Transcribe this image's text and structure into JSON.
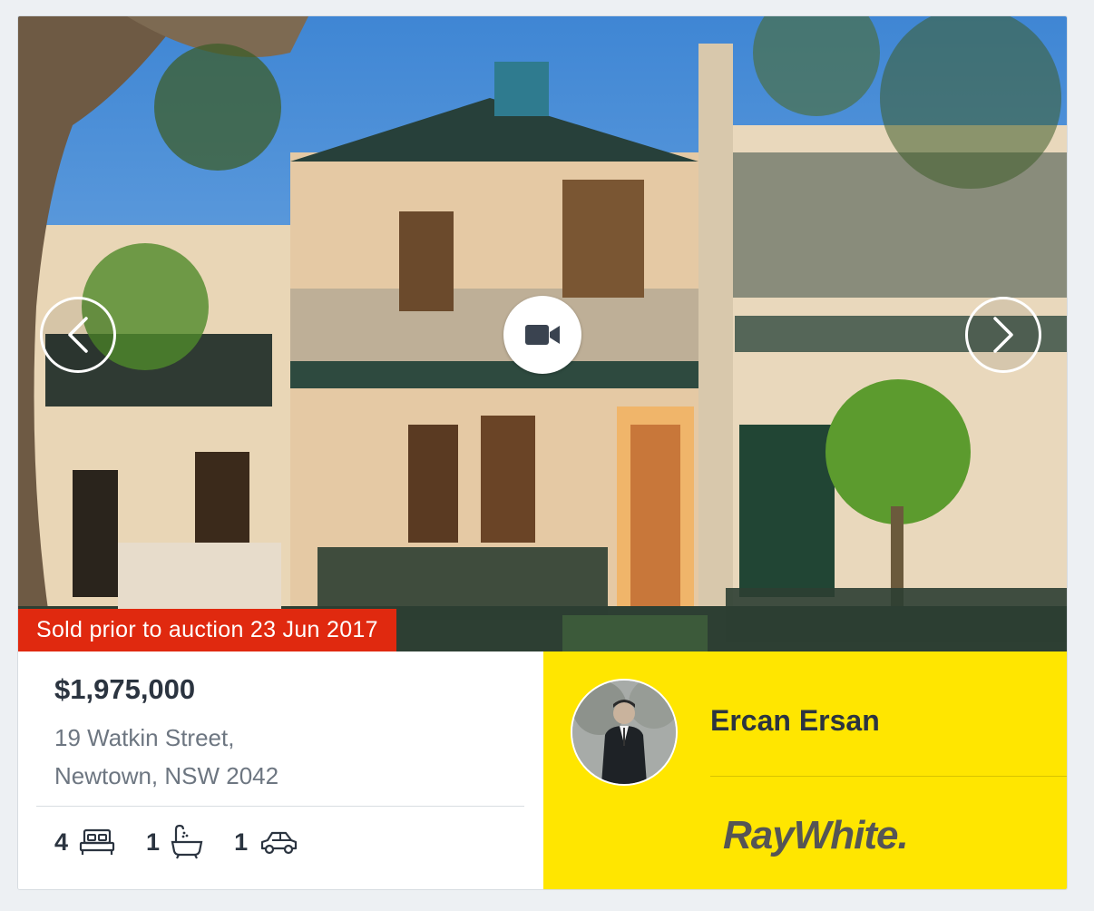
{
  "listing": {
    "status_banner": "Sold prior to auction 23 Jun 2017",
    "price": "$1,975,000",
    "address_line1": "19 Watkin Street,",
    "address_line2": "Newtown, NSW 2042",
    "features": [
      {
        "count": "4",
        "icon": "bed-icon"
      },
      {
        "count": "1",
        "icon": "bath-icon"
      },
      {
        "count": "1",
        "icon": "car-icon"
      }
    ]
  },
  "gallery": {
    "prev_icon": "chevron-left-icon",
    "next_icon": "chevron-right-icon",
    "video_icon": "video-camera-icon"
  },
  "agent": {
    "name": "Ercan Ersan",
    "agency_logo_text": "RayWhite."
  },
  "colors": {
    "banner_red": "#e0290f",
    "agency_yellow": "#ffe600",
    "text_dark": "#2b3440",
    "text_muted": "#6d7681"
  }
}
